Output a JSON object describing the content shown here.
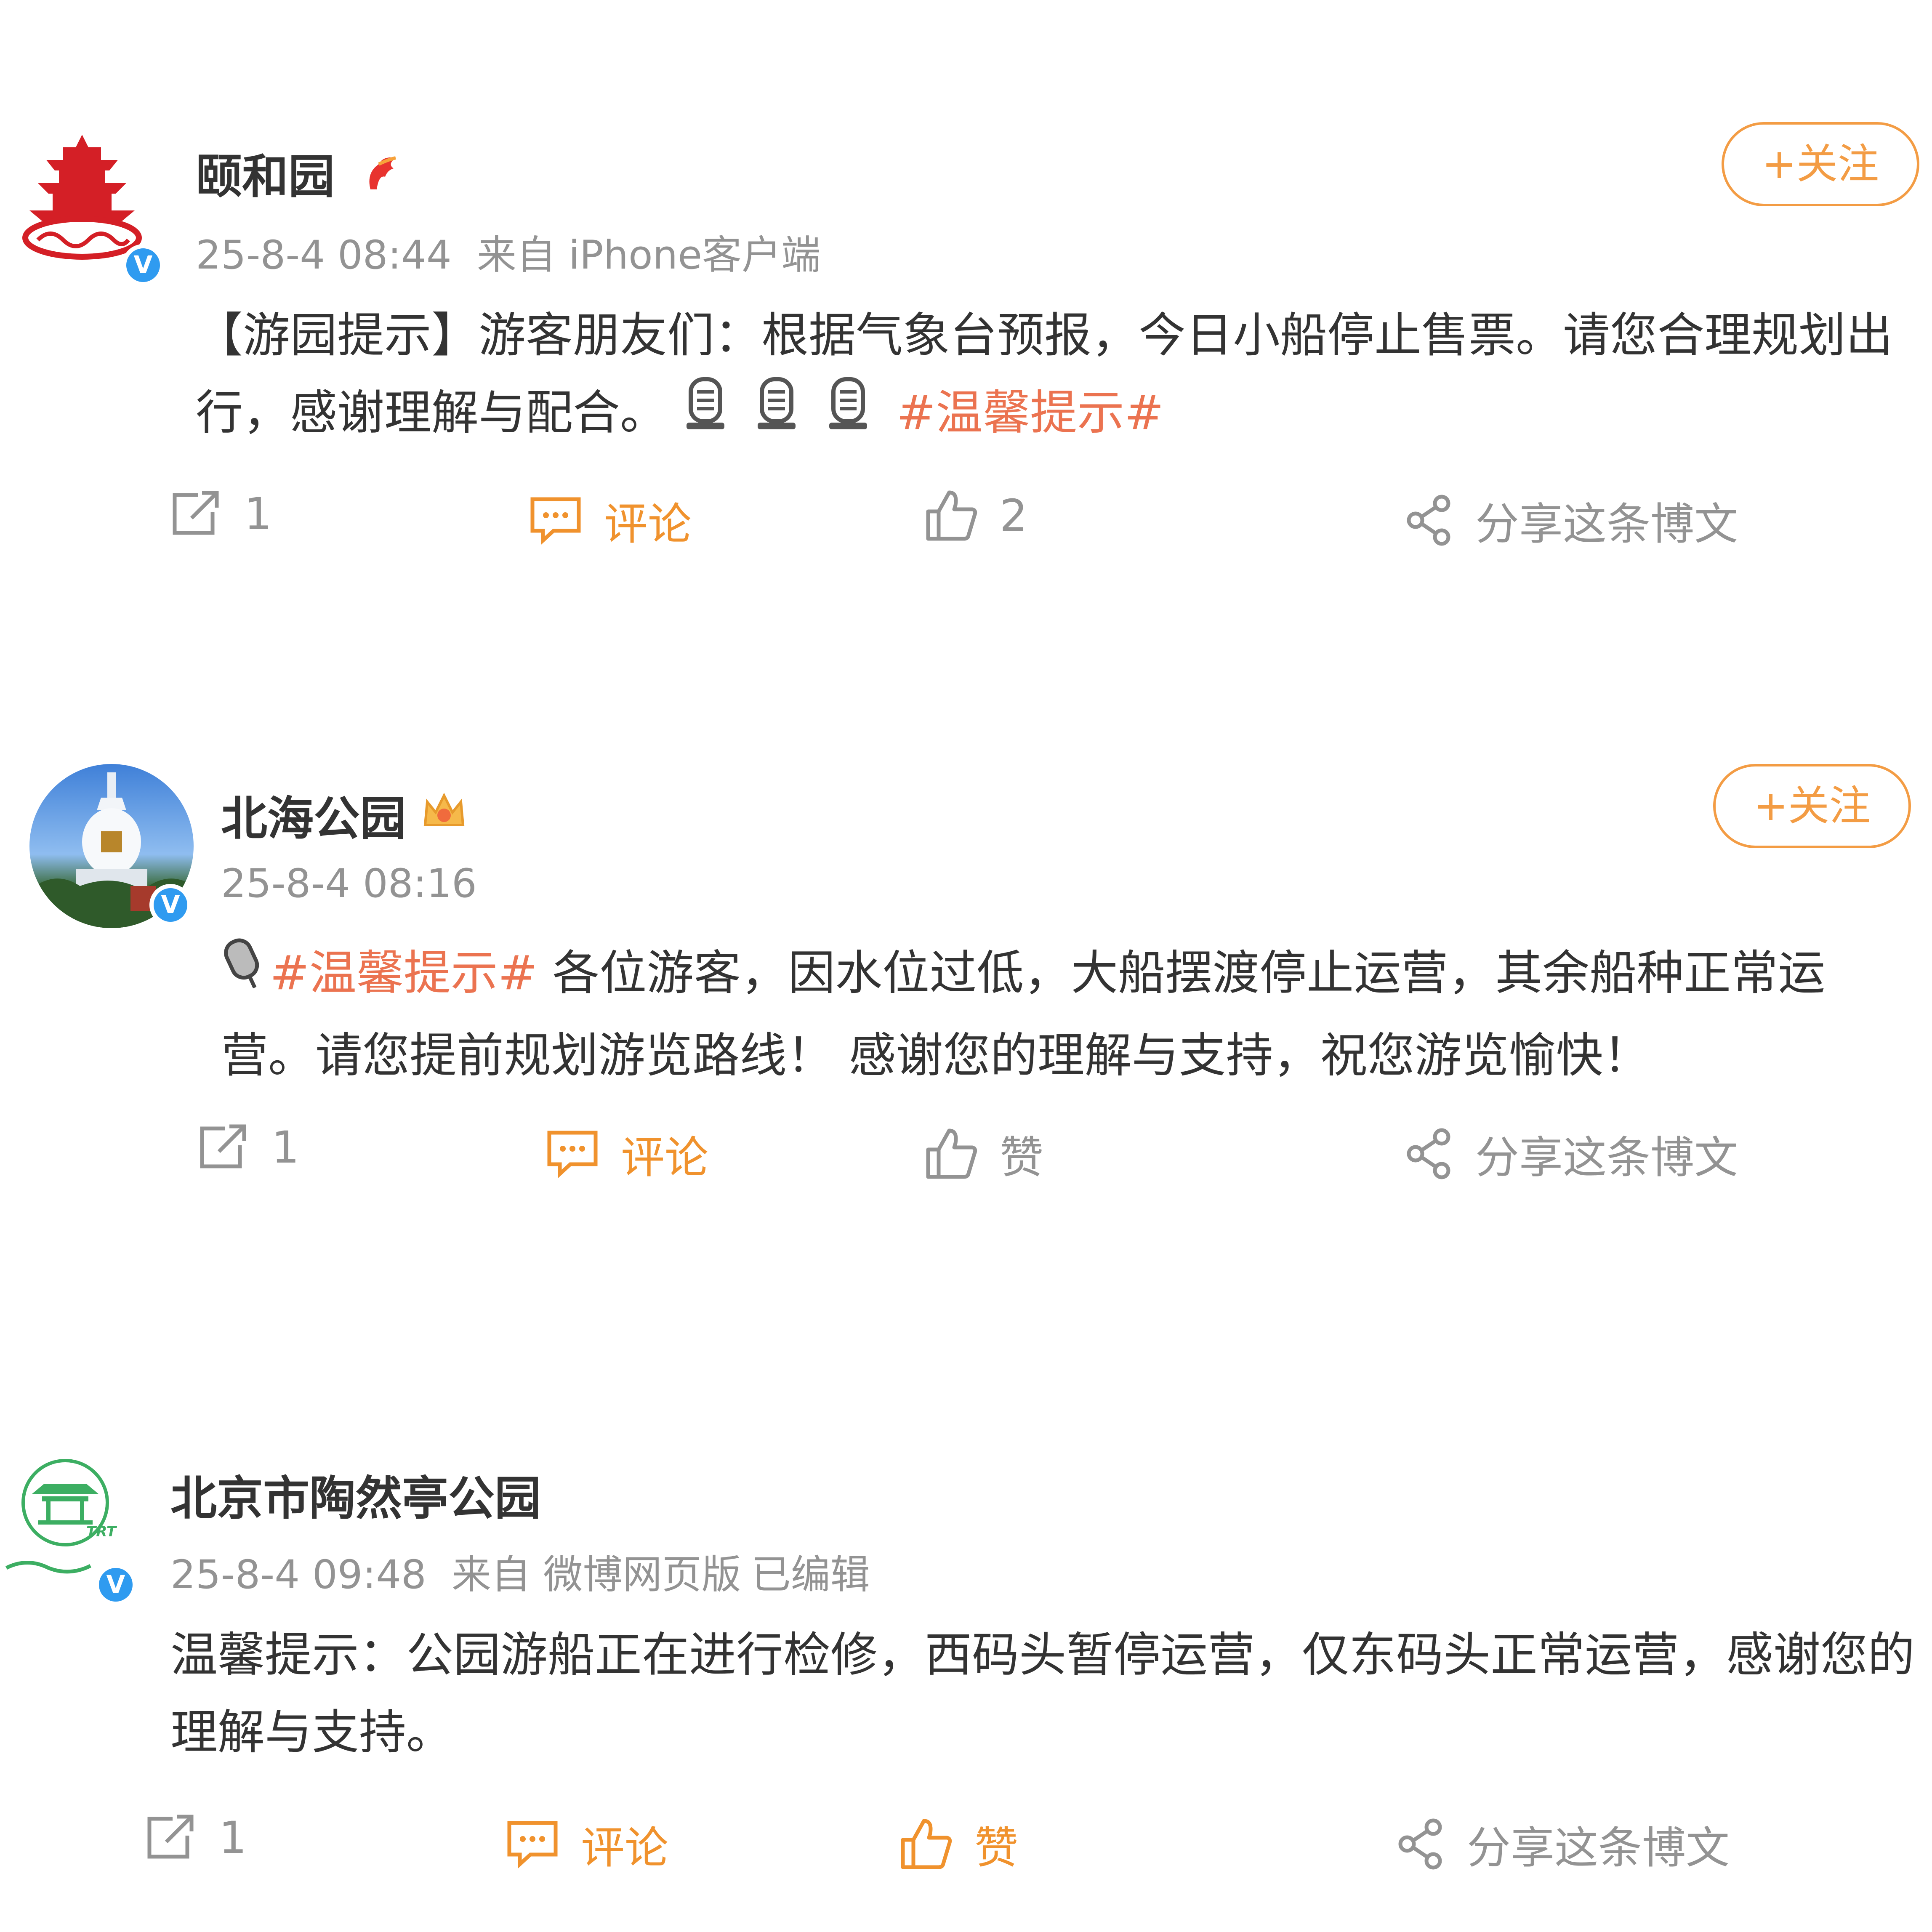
{
  "posts": [
    {
      "name": "颐和园",
      "time": "25-8-4 08:44",
      "source": "来自 iPhone客户端",
      "edited": "",
      "content_text": "【游园提示】游客朋友们：根据气象台预报，今日小船停止售票。请您合理规划出行，感谢理解与配合。",
      "hashtag": "#温馨提示#",
      "follow_label": "+关注",
      "forward_count": "1",
      "comment_label": "评论",
      "like_label": "2",
      "share_label": "分享这条博文",
      "name_badge_icon": "flame-badge-icon",
      "avatar_icon": "summer-palace-logo-icon"
    },
    {
      "name": "北海公园",
      "time": "25-8-4 08:16",
      "source": "",
      "edited": "",
      "hashtag": "#温馨提示#",
      "content_text": "各位游客，因水位过低，大船摆渡停止运营，其余船种正常运营。请您提前规划游览路线！ 感谢您的理解与支持，祝您游览愉快！",
      "follow_label": "+关注",
      "forward_count": "1",
      "comment_label": "评论",
      "like_label": "赞",
      "share_label": "分享这条博文",
      "name_badge_icon": "crown-badge-icon",
      "avatar_icon": "white-pagoda-photo-icon"
    },
    {
      "name": "北京市陶然亭公园",
      "time": "25-8-4 09:48",
      "source": "来自 微博网页版",
      "edited": "已编辑",
      "content_text": "温馨提示：公园游船正在进行检修，西码头暂停运营，仅东码头正常运营，感谢您的理解与支持。",
      "forward_count": "1",
      "comment_label": "评论",
      "like_label": "赞",
      "share_label": "分享这条博文",
      "avatar_icon": "taoranting-logo-icon"
    }
  ],
  "colors": {
    "accent_orange": "#f39c44",
    "hashtag": "#eb7350",
    "verified_blue": "#2f9bf0",
    "meta_gray": "#939393"
  }
}
